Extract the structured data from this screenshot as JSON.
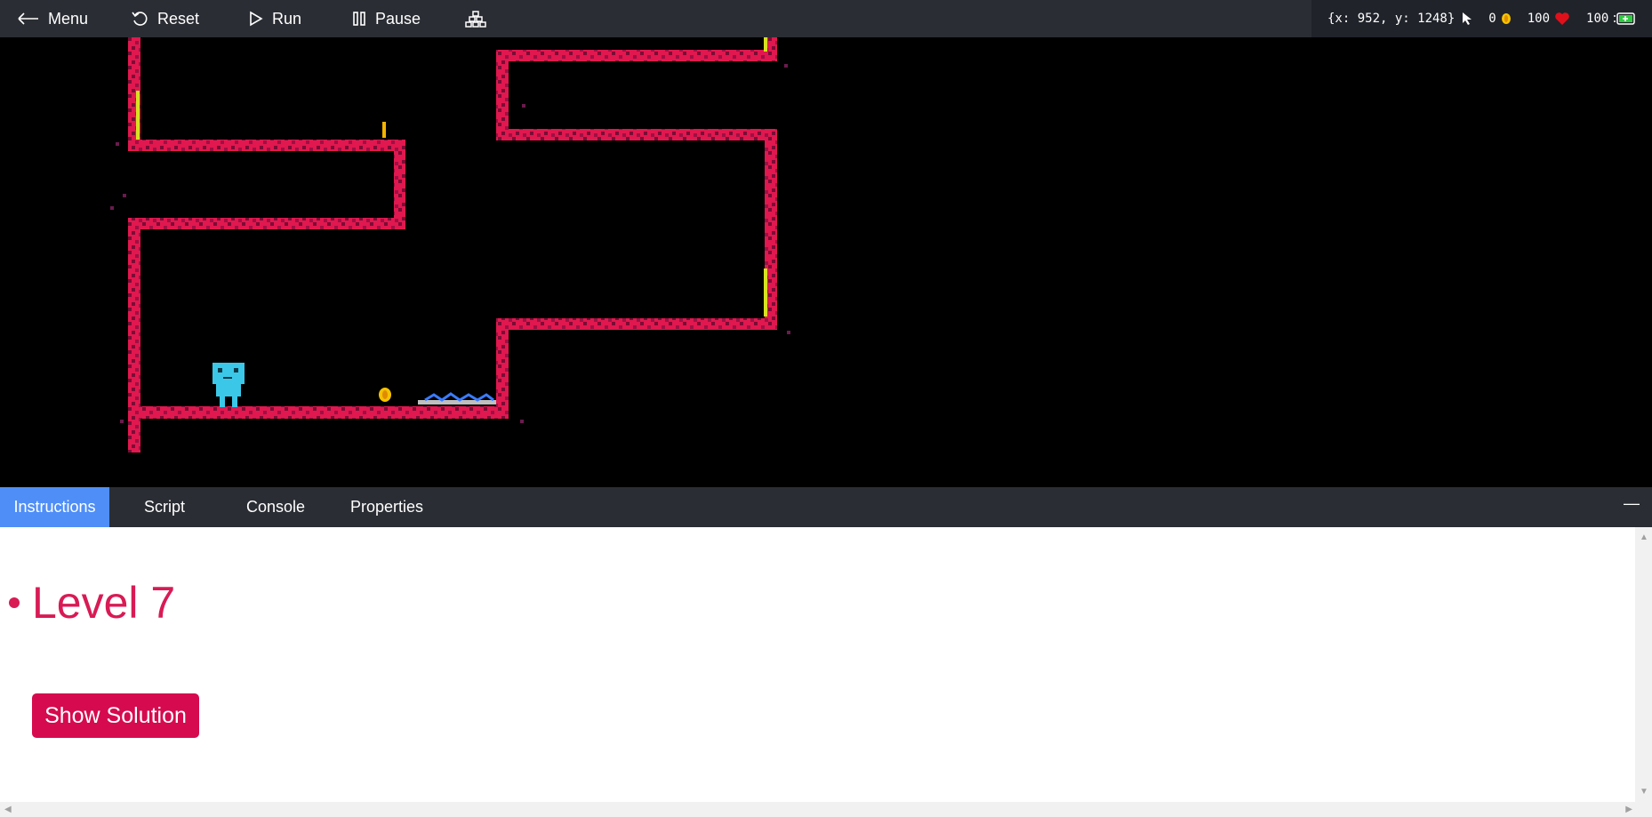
{
  "toolbar": {
    "menu_label": "Menu",
    "reset_label": "Reset",
    "run_label": "Run",
    "pause_label": "Pause"
  },
  "stats": {
    "coords": "{x: 952, y: 1248}",
    "coins": "0",
    "health": "100",
    "energy": "100"
  },
  "tabs": [
    "Instructions",
    "Script",
    "Console",
    "Properties"
  ],
  "instructions": {
    "level_title": "Level 7",
    "solution_button": "Show Solution"
  },
  "colors": {
    "toolbar_bg": "#2a2d33",
    "accent_tab": "#4f8ef7",
    "brand": "#d60a4e",
    "wall": "#e0184f"
  }
}
